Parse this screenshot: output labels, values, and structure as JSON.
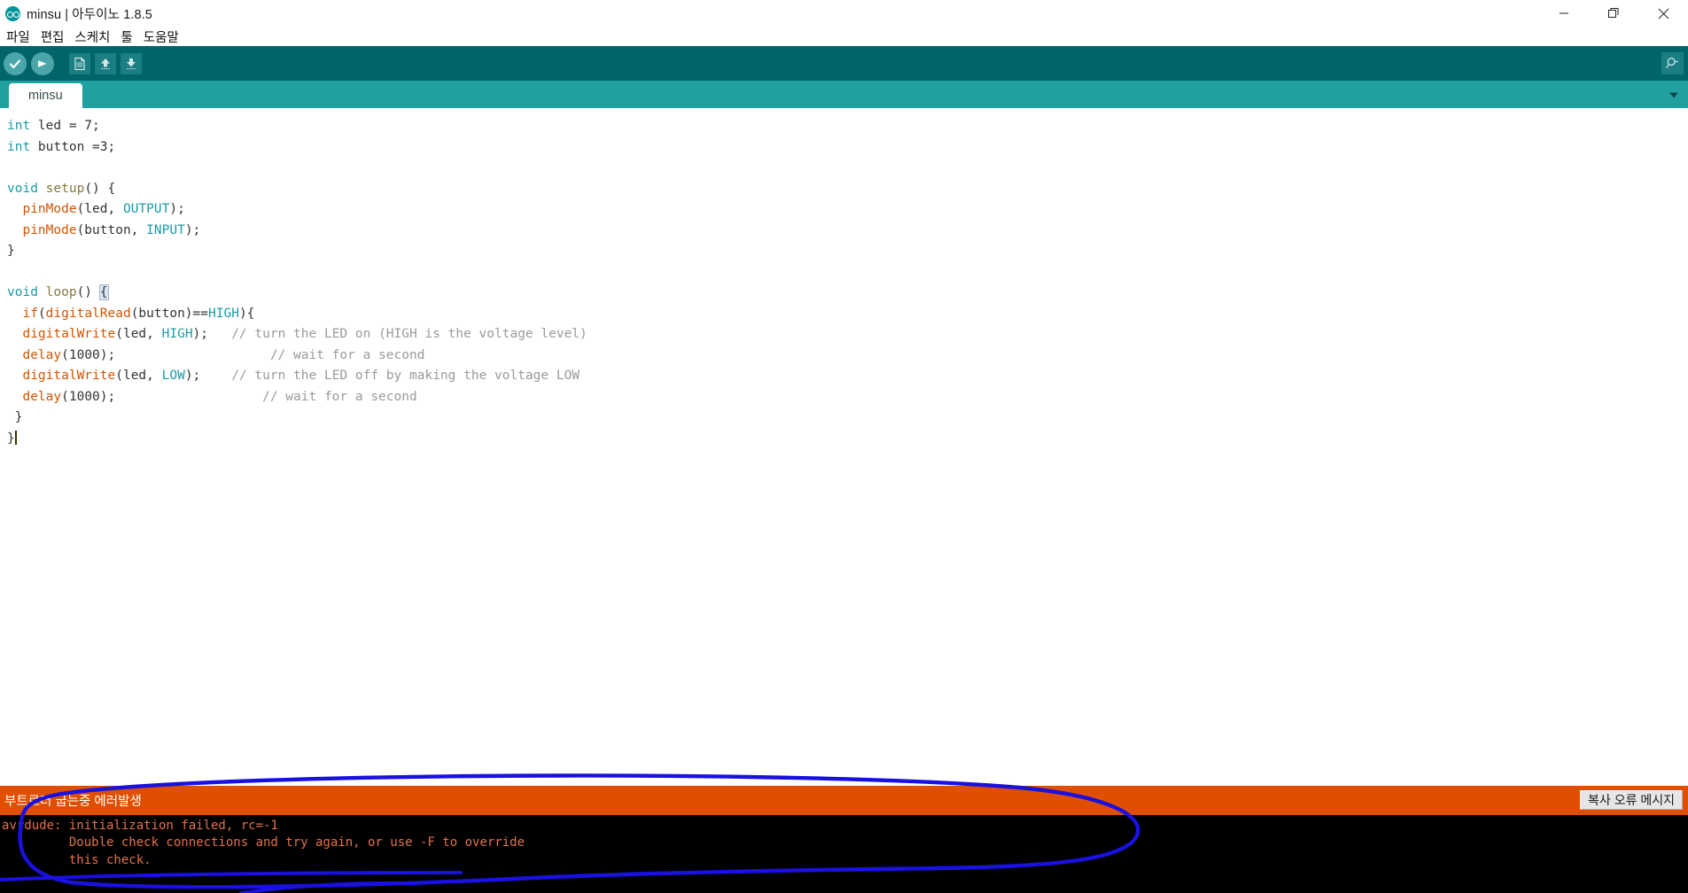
{
  "window": {
    "title": "minsu | 아두이노 1.8.5",
    "logo_icon": "arduino-infinity-icon",
    "controls": {
      "minimize": "minimize-icon",
      "restore": "restore-icon",
      "close": "close-icon"
    }
  },
  "menubar": {
    "items": [
      {
        "label": "파일"
      },
      {
        "label": "편집"
      },
      {
        "label": "스케치"
      },
      {
        "label": "툴"
      },
      {
        "label": "도움말"
      }
    ]
  },
  "toolbar": {
    "verify_icon": "checkmark-icon",
    "upload_icon": "arrow-right-icon",
    "new_icon": "new-document-icon",
    "open_icon": "arrow-up-icon",
    "save_icon": "arrow-down-icon",
    "serial_monitor_icon": "magnifier-icon",
    "colors": {
      "bar_bg": "#006468",
      "round_btn_bg": "#4ba6a9",
      "square_btn_bg": "#1b7e83"
    }
  },
  "tabbar": {
    "bg_color": "#20a0a0",
    "tabs": [
      {
        "label": "minsu",
        "active": true
      }
    ],
    "menu_icon": "chevron-down-icon"
  },
  "editor": {
    "lines": [
      {
        "segments": [
          {
            "t": "int",
            "c": "kw"
          },
          {
            "t": " led = 7;",
            "c": "plain"
          }
        ]
      },
      {
        "segments": [
          {
            "t": "int",
            "c": "kw"
          },
          {
            "t": " button =3;",
            "c": "plain"
          }
        ]
      },
      {
        "segments": []
      },
      {
        "segments": [
          {
            "t": "void",
            "c": "kw"
          },
          {
            "t": " ",
            "c": "plain"
          },
          {
            "t": "setup",
            "c": "fn"
          },
          {
            "t": "() {",
            "c": "plain"
          }
        ]
      },
      {
        "segments": [
          {
            "t": "  ",
            "c": "plain"
          },
          {
            "t": "pinMode",
            "c": "call"
          },
          {
            "t": "(led, ",
            "c": "plain"
          },
          {
            "t": "OUTPUT",
            "c": "const"
          },
          {
            "t": ");",
            "c": "plain"
          }
        ]
      },
      {
        "segments": [
          {
            "t": "  ",
            "c": "plain"
          },
          {
            "t": "pinMode",
            "c": "call"
          },
          {
            "t": "(button, ",
            "c": "plain"
          },
          {
            "t": "INPUT",
            "c": "const"
          },
          {
            "t": ");",
            "c": "plain"
          }
        ]
      },
      {
        "segments": [
          {
            "t": "}",
            "c": "plain"
          }
        ]
      },
      {
        "segments": []
      },
      {
        "segments": [
          {
            "t": "void",
            "c": "kw"
          },
          {
            "t": " ",
            "c": "plain"
          },
          {
            "t": "loop",
            "c": "fn"
          },
          {
            "t": "() ",
            "c": "plain"
          },
          {
            "t": "{",
            "c": "brace-hl"
          }
        ]
      },
      {
        "segments": [
          {
            "t": "  ",
            "c": "plain"
          },
          {
            "t": "if",
            "c": "call"
          },
          {
            "t": "(",
            "c": "plain"
          },
          {
            "t": "digitalRead",
            "c": "call"
          },
          {
            "t": "(button)==",
            "c": "plain"
          },
          {
            "t": "HIGH",
            "c": "const"
          },
          {
            "t": "){",
            "c": "plain"
          }
        ]
      },
      {
        "segments": [
          {
            "t": "  ",
            "c": "plain"
          },
          {
            "t": "digitalWrite",
            "c": "call"
          },
          {
            "t": "(led, ",
            "c": "plain"
          },
          {
            "t": "HIGH",
            "c": "const"
          },
          {
            "t": ");   ",
            "c": "plain"
          },
          {
            "t": "// turn the LED on (HIGH is the voltage level)",
            "c": "cmt"
          }
        ]
      },
      {
        "segments": [
          {
            "t": "  ",
            "c": "plain"
          },
          {
            "t": "delay",
            "c": "call"
          },
          {
            "t": "(1000);                    ",
            "c": "plain"
          },
          {
            "t": "// wait for a second",
            "c": "cmt"
          }
        ]
      },
      {
        "segments": [
          {
            "t": "  ",
            "c": "plain"
          },
          {
            "t": "digitalWrite",
            "c": "call"
          },
          {
            "t": "(led, ",
            "c": "plain"
          },
          {
            "t": "LOW",
            "c": "const"
          },
          {
            "t": ");    ",
            "c": "plain"
          },
          {
            "t": "// turn the LED off by making the voltage LOW",
            "c": "cmt"
          }
        ]
      },
      {
        "segments": [
          {
            "t": "  ",
            "c": "plain"
          },
          {
            "t": "delay",
            "c": "call"
          },
          {
            "t": "(1000);                   ",
            "c": "plain"
          },
          {
            "t": "// wait for a second",
            "c": "cmt"
          }
        ]
      },
      {
        "segments": [
          {
            "t": " }",
            "c": "plain"
          }
        ]
      },
      {
        "segments": [
          {
            "t": "}",
            "c": "plain"
          }
        ],
        "caret": true
      }
    ]
  },
  "statusbar": {
    "message": "부트로더 굽는중 에러발생",
    "copy_error_label": "복사 오류 메시지",
    "bg_color": "#e04f00"
  },
  "console": {
    "bg_color": "#000000",
    "text_color": "#e2714c",
    "lines": [
      "avrdude: initialization failed, rc=-1",
      "         Double check connections and try again, or use -F to override",
      "         this check."
    ]
  },
  "annotation": {
    "type": "hand-drawn-ellipse-with-tail",
    "color": "#1a10e0"
  }
}
